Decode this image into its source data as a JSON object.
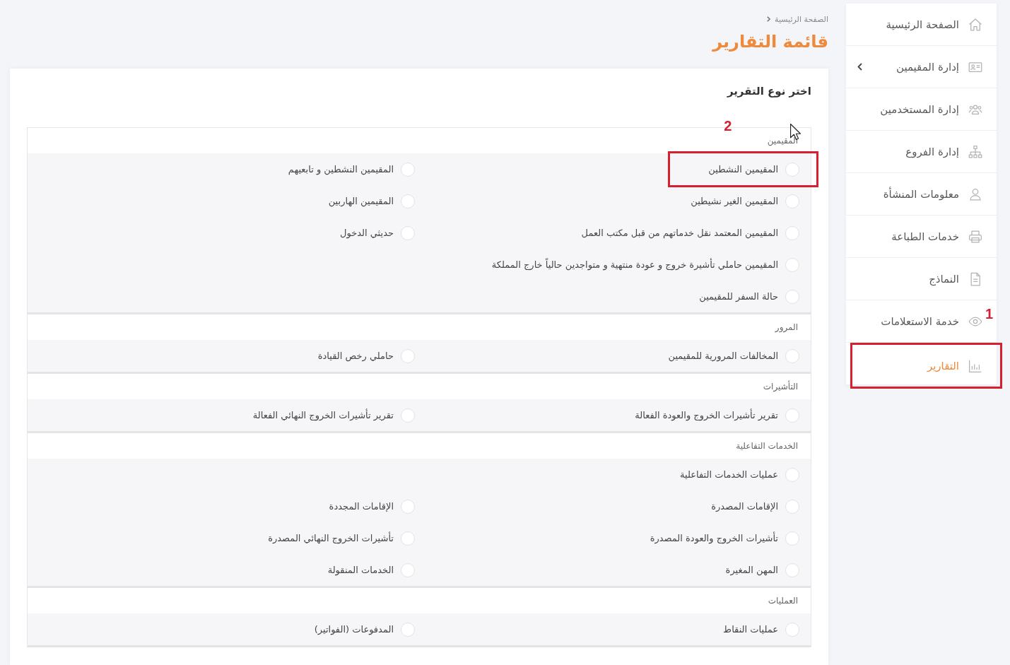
{
  "breadcrumb": {
    "label": "الصفحة الرئيسية"
  },
  "page_title": "قائمة التقارير",
  "sidebar": {
    "items": [
      {
        "label": "الصفحة الرئيسية",
        "selected": false,
        "submenu": false
      },
      {
        "label": "إدارة المقيمين",
        "selected": false,
        "submenu": true
      },
      {
        "label": "إدارة المستخدمين",
        "selected": false,
        "submenu": false
      },
      {
        "label": "إدارة الفروع",
        "selected": false,
        "submenu": false
      },
      {
        "label": "معلومات المنشأة",
        "selected": false,
        "submenu": false
      },
      {
        "label": "خدمات الطباعة",
        "selected": false,
        "submenu": false
      },
      {
        "label": "النماذج",
        "selected": false,
        "submenu": false
      },
      {
        "label": "خدمة الاستعلامات",
        "selected": false,
        "submenu": false
      },
      {
        "label": "التقارير",
        "selected": true,
        "submenu": false,
        "annotation": "1"
      }
    ]
  },
  "report_card": {
    "heading": "اختر نوع التقرير",
    "sections": [
      {
        "title": "المقيمين",
        "rows": [
          {
            "options": [
              {
                "label": "المقيمين النشطين",
                "selected": false,
                "annotation": "2"
              },
              {
                "label": "المقيمين النشطين و تابعيهم",
                "selected": false
              }
            ]
          },
          {
            "options": [
              {
                "label": "المقيمين الغير نشيطين",
                "selected": false
              },
              {
                "label": "المقيمين الهاربين",
                "selected": false
              }
            ]
          },
          {
            "options": [
              {
                "label": "المقيمين المعتمد نقل خدماتهم من قبل مكتب العمل",
                "selected": false
              },
              {
                "label": "حديثي الدخول",
                "selected": false
              }
            ]
          },
          {
            "options": [
              {
                "label": "المقيمين حاملي تأشيرة خروج و عودة منتهية و متواجدين حالياً خارج المملكة",
                "selected": false
              }
            ]
          },
          {
            "options": [
              {
                "label": "حالة السفر للمقيمين",
                "selected": false
              }
            ]
          }
        ]
      },
      {
        "title": "المرور",
        "rows": [
          {
            "options": [
              {
                "label": "المخالفات المرورية للمقيمين",
                "selected": false
              },
              {
                "label": "حاملي رخص القيادة",
                "selected": false
              }
            ]
          }
        ]
      },
      {
        "title": "التأشيرات",
        "rows": [
          {
            "options": [
              {
                "label": "تقرير تأشيرات الخروج والعودة الفعالة",
                "selected": false
              },
              {
                "label": "تقرير تأشيرات الخروج النهائي الفعالة",
                "selected": false
              }
            ]
          }
        ]
      },
      {
        "title": "الخدمات التفاعلية",
        "rows": [
          {
            "options": [
              {
                "label": "عمليات الخدمات التفاعلية",
                "selected": false
              }
            ]
          },
          {
            "options": [
              {
                "label": "الإقامات المصدرة",
                "selected": false
              },
              {
                "label": "الإقامات المجددة",
                "selected": false
              }
            ]
          },
          {
            "options": [
              {
                "label": "تأشيرات الخروج والعودة المصدرة",
                "selected": false
              },
              {
                "label": "تأشيرات الخروج النهائي المصدرة",
                "selected": false
              }
            ]
          },
          {
            "options": [
              {
                "label": "المهن المغيرة",
                "selected": false
              },
              {
                "label": "الخدمات المنقولة",
                "selected": false
              }
            ]
          }
        ]
      },
      {
        "title": "العمليات",
        "rows": [
          {
            "options": [
              {
                "label": "عمليات النقاط",
                "selected": false
              },
              {
                "label": "المدفوعات (الفواتير)",
                "selected": false
              }
            ]
          }
        ]
      }
    ]
  }
}
